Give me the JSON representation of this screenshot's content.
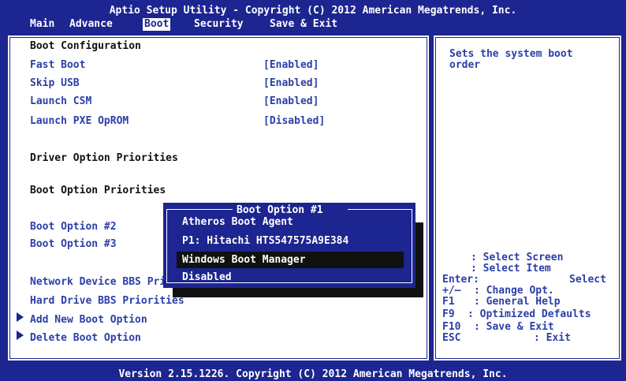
{
  "header": {
    "title": "Aptio Setup Utility - Copyright (C) 2012 American Megatrends, Inc.",
    "tabs": [
      "Main",
      "Advance",
      "Boot",
      "Security",
      "Save & Exit"
    ],
    "active_tab": "Boot"
  },
  "left": {
    "section_title": "Boot Configuration",
    "settings": [
      {
        "label": "Fast Boot",
        "value": "[Enabled]"
      },
      {
        "label": "Skip USB",
        "value": "[Enabled]"
      },
      {
        "label": "Launch CSM",
        "value": "[Enabled]"
      },
      {
        "label": "Launch PXE OpROM",
        "value": "[Disabled]"
      }
    ],
    "driver_priorities": "Driver Option Priorities",
    "boot_priorities": "Boot Option Priorities",
    "boot_options": [
      "Boot Option #1",
      "Boot Option #2",
      "Boot Option #3"
    ],
    "network_bbs": "Network Device BBS Priorities",
    "hdd_bbs": "Hard Drive BBS Priorities",
    "add_boot": "Add New Boot Option",
    "delete_boot": "Delete Boot Option"
  },
  "popup": {
    "title": "Boot Option #1",
    "options": [
      "Atheros Boot Agent",
      "P1: Hitachi HTS547575A9E384",
      "Windows Boot Manager",
      "Disabled"
    ],
    "selected": "Windows Boot Manager"
  },
  "right": {
    "help_text_1": "Sets the system boot",
    "help_text_2": "order",
    "keys": [
      {
        "key": "",
        "desc": ": Select Screen"
      },
      {
        "key": "",
        "desc": ": Select Item"
      },
      {
        "key": "Enter:",
        "desc": "Select"
      },
      {
        "key": "+/—",
        "desc": ": Change Opt."
      },
      {
        "key": "F1",
        "desc": ": General Help"
      },
      {
        "key": "F9",
        "desc": ": Optimized Defaults"
      },
      {
        "key": "F10",
        "desc": ": Save & Exit"
      },
      {
        "key": "ESC",
        "desc": ": Exit"
      }
    ]
  },
  "footer": {
    "text": "Version 2.15.1226. Copyright (C) 2012 American Megatrends, Inc."
  },
  "colors": {
    "bios_blue": "#1c2590",
    "text_blue": "#2b3fa8"
  }
}
